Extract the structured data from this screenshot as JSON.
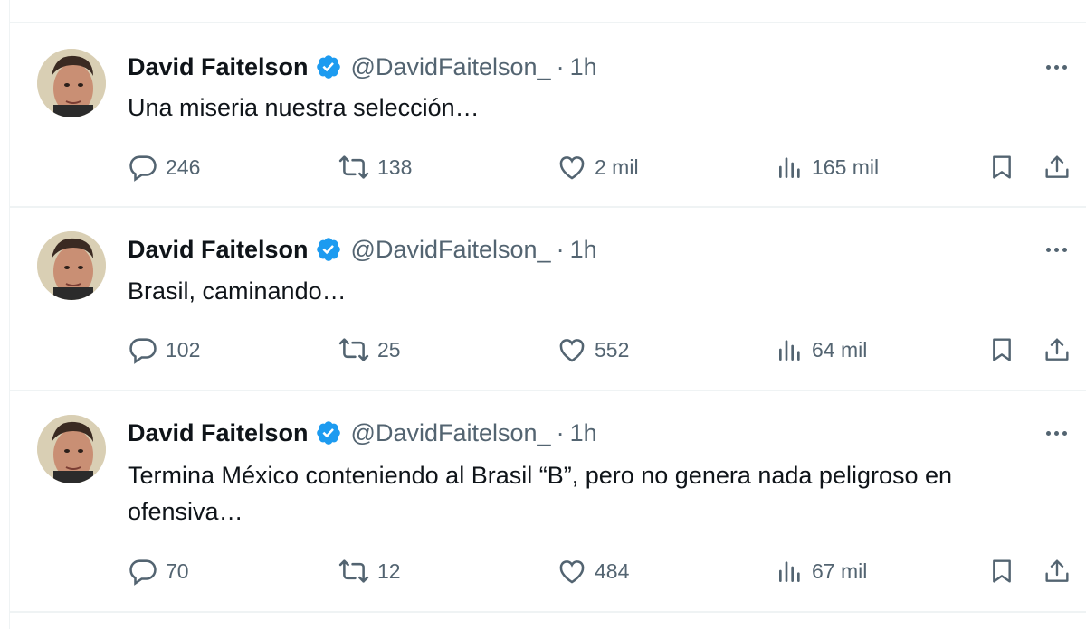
{
  "tweets": [
    {
      "author_name": "David Faitelson",
      "handle": "@DavidFaitelson_",
      "separator": "·",
      "time": "1h",
      "text": "Una miseria nuestra selección…",
      "replies": "246",
      "retweets": "138",
      "likes": "2 mil",
      "views": "165 mil"
    },
    {
      "author_name": "David Faitelson",
      "handle": "@DavidFaitelson_",
      "separator": "·",
      "time": "1h",
      "text": "Brasil, caminando…",
      "replies": "102",
      "retweets": "25",
      "likes": "552",
      "views": "64 mil"
    },
    {
      "author_name": "David Faitelson",
      "handle": "@DavidFaitelson_",
      "separator": "·",
      "time": "1h",
      "text": "Termina México conteniendo al Brasil “B”, pero no genera nada peligroso en ofensiva…",
      "replies": "70",
      "retweets": "12",
      "likes": "484",
      "views": "67 mil"
    }
  ],
  "colors": {
    "verified_badge": "#1d9bf0",
    "secondary_text": "#536471",
    "primary_text": "#0f1419",
    "divider": "#eff3f4"
  },
  "icons": [
    "reply-icon",
    "retweet-icon",
    "like-icon",
    "views-icon",
    "bookmark-icon",
    "share-icon",
    "verified-badge-icon",
    "more-options-icon"
  ]
}
